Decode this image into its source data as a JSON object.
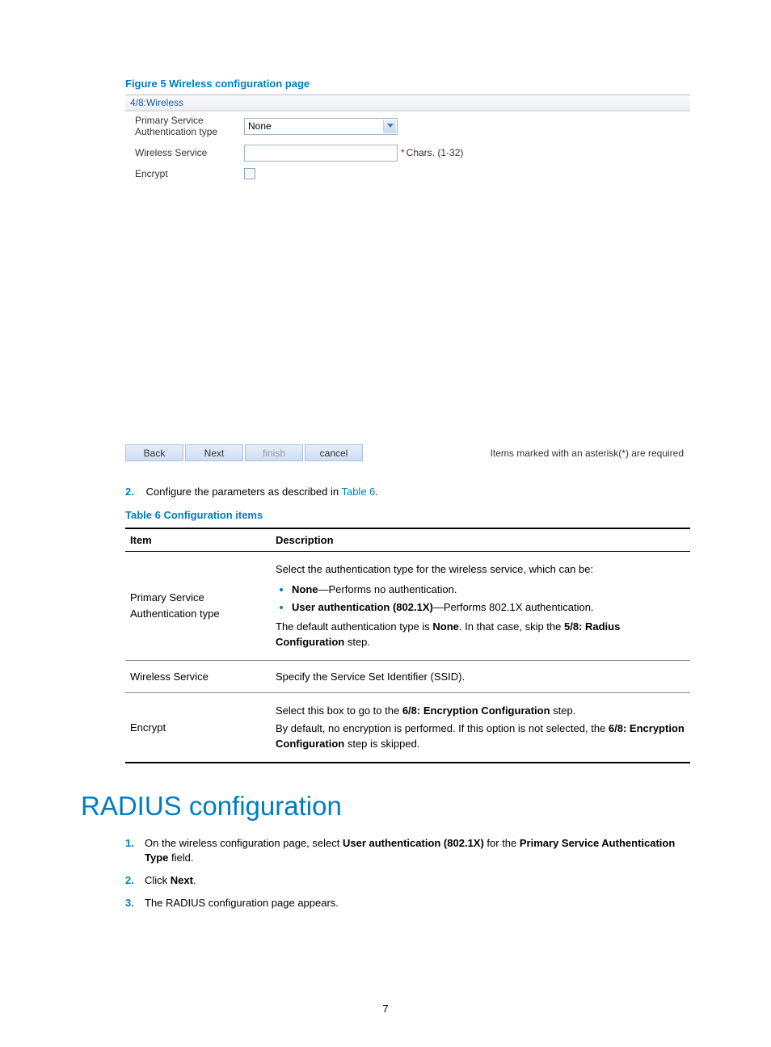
{
  "figure_caption": "Figure 5 Wireless configuration page",
  "panel": {
    "title": "4/8:Wireless",
    "row1_label": "Primary Service Authentication type",
    "row1_value": "None",
    "row2_label": "Wireless Service",
    "row2_hint": "Chars. (1-32)",
    "row3_label": "Encrypt"
  },
  "buttons": {
    "back": "Back",
    "next": "Next",
    "finish": "finish",
    "cancel": "cancel"
  },
  "required_note": "Items marked with an asterisk(*) are required",
  "step2_num": "2.",
  "step2_text_a": "Configure the parameters as described in ",
  "step2_link": "Table 6",
  "step2_text_b": ".",
  "table_caption": "Table 6 Configuration items",
  "table": {
    "h1": "Item",
    "h2": "Description",
    "r1_item": "Primary Service Authentication type",
    "r1_p1": "Select the authentication type for the wireless service, which can be:",
    "r1_b1a": "None",
    "r1_b1b": "—Performs no authentication.",
    "r1_b2a": "User authentication (802.1X)",
    "r1_b2b": "—Performs 802.1X authentication.",
    "r1_p2a": "The default authentication type is ",
    "r1_p2b": "None",
    "r1_p2c": ". In that case, skip the ",
    "r1_p2d": "5/8: Radius Configuration",
    "r1_p2e": " step.",
    "r2_item": "Wireless Service",
    "r2_desc": "Specify the Service Set Identifier (SSID).",
    "r3_item": "Encrypt",
    "r3_p1a": "Select this box to go to the ",
    "r3_p1b": "6/8: Encryption Configuration",
    "r3_p1c": " step.",
    "r3_p2a": "By default, no encryption is performed. If this option is not selected, the ",
    "r3_p2b": "6/8: Encryption Configuration",
    "r3_p2c": " step is skipped."
  },
  "section_heading": "RADIUS configuration",
  "radius_steps": {
    "n1": "1.",
    "s1a": "On the wireless configuration page, select ",
    "s1b": "User authentication (802.1X)",
    "s1c": " for the ",
    "s1d": "Primary Service Authentication Type",
    "s1e": " field.",
    "n2": "2.",
    "s2a": "Click ",
    "s2b": "Next",
    "s2c": ".",
    "n3": "3.",
    "s3": "The RADIUS configuration page appears."
  },
  "page_number": "7"
}
